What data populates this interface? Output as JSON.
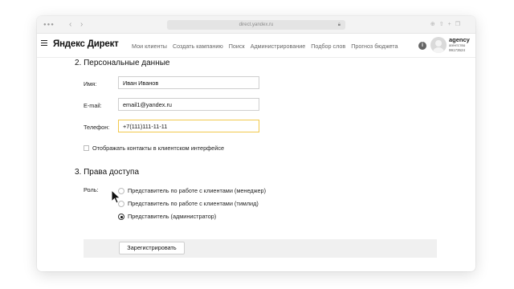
{
  "browser": {
    "url": "direct.yandex.ru"
  },
  "header": {
    "logo": "Яндекс Директ",
    "nav": [
      "Мои клиенты",
      "Создать кампанию",
      "Поиск",
      "Администрирование",
      "Подбор слов",
      "Прогноз бюджета"
    ],
    "agency_name": "agency",
    "agency_line1": "агентство",
    "agency_line2": "99173524"
  },
  "form": {
    "personal_title": "2. Персональные данные",
    "name_label": "Имя:",
    "name_value": "Иван Иванов",
    "email_label": "E-mail:",
    "email_value": "email1@yandex.ru",
    "phone_label": "Телефон:",
    "phone_value": "+7(111)111-11-11",
    "show_contacts_label": "Отображать контакты в клиентском интерфейсе",
    "show_contacts_checked": false,
    "access_title": "3. Права доступа",
    "role_label": "Роль:",
    "roles": [
      {
        "label": "Представитель по работе с клиентами (менеджер)",
        "checked": false
      },
      {
        "label": "Представитель по работе с клиентами (тимлид)",
        "checked": false
      },
      {
        "label": "Представитель (администратор)",
        "checked": true
      }
    ],
    "submit_label": "Зарегистрировать"
  }
}
